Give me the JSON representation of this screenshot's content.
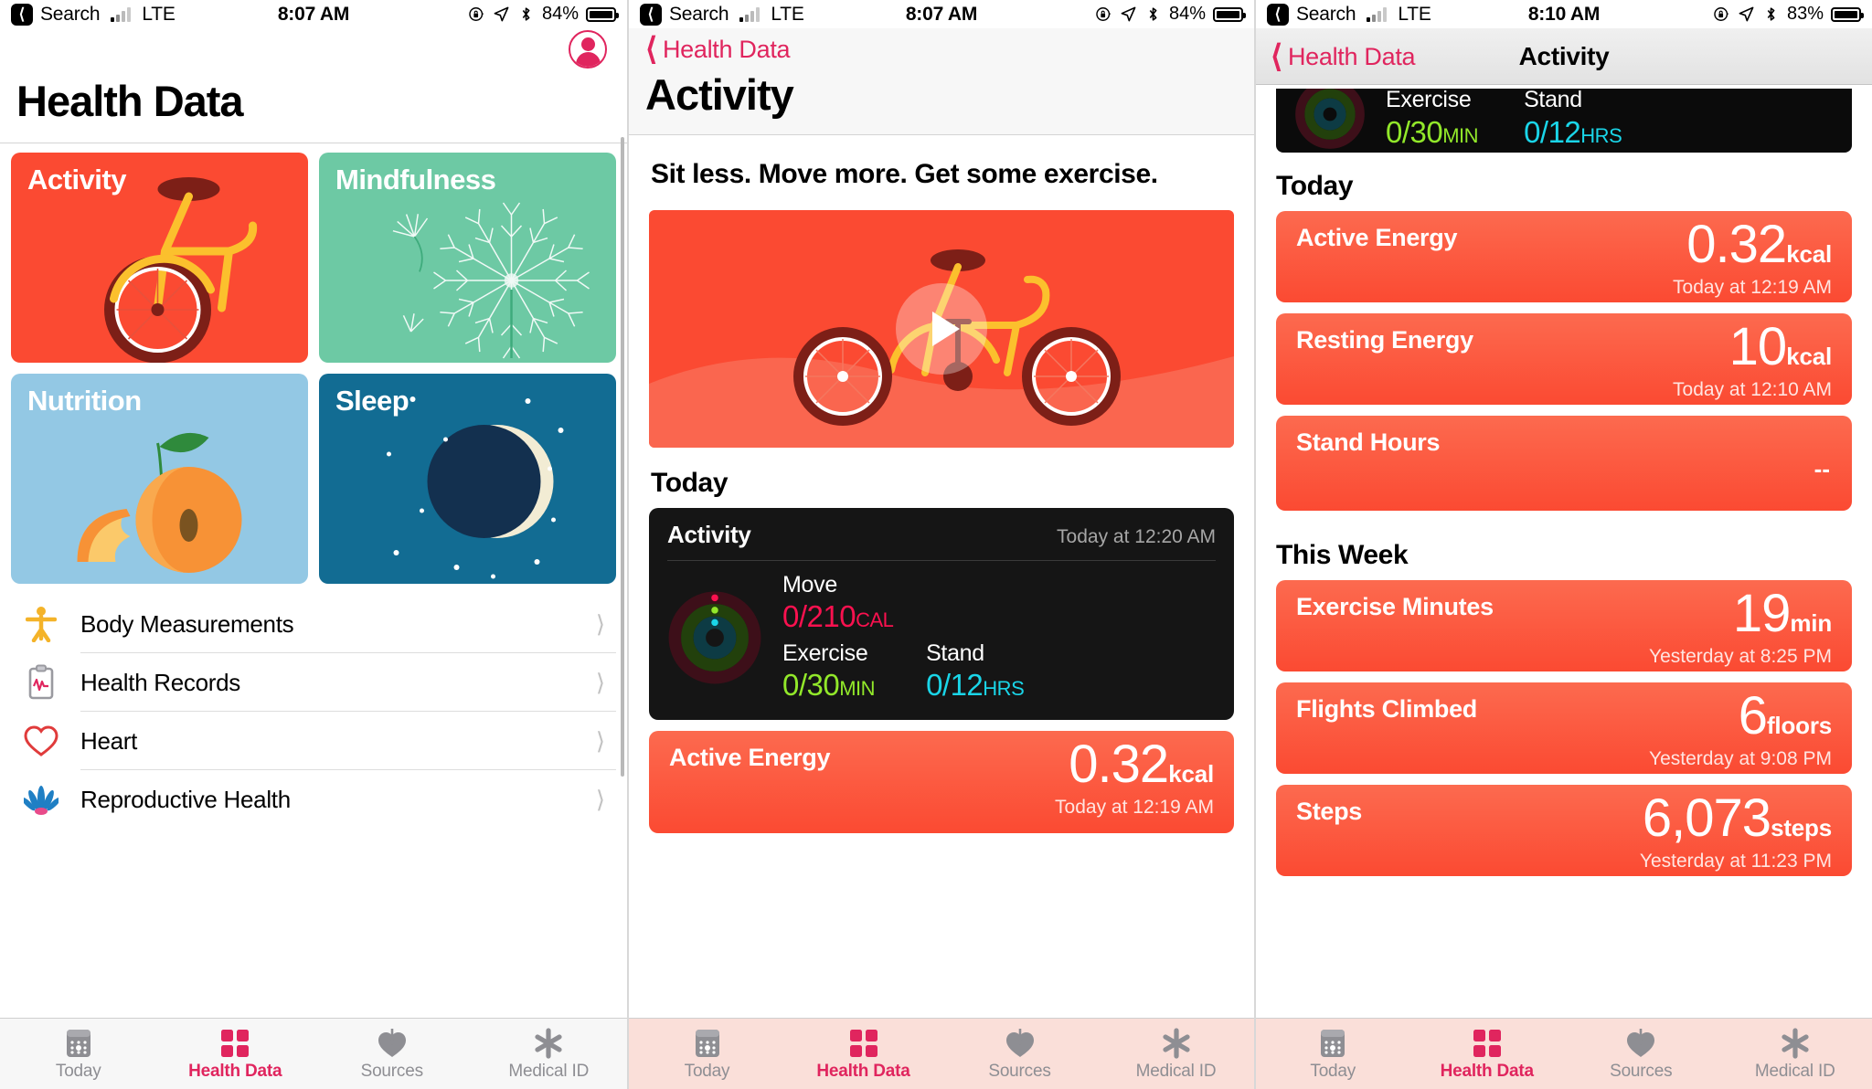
{
  "panel1": {
    "status": {
      "back_label": "Search",
      "carrier": "LTE",
      "time": "8:07 AM",
      "battery_pct": "84%",
      "icons": [
        "rotation-lock-icon",
        "location-arrow-icon",
        "bluetooth-icon",
        "battery-icon"
      ]
    },
    "title": "Health Data",
    "avatar_name": "profile-avatar",
    "tiles": [
      {
        "label": "Activity",
        "color": "#fb4a32",
        "art": "bicycle"
      },
      {
        "label": "Mindfulness",
        "color": "#6dc9a4",
        "art": "dandelion"
      },
      {
        "label": "Nutrition",
        "color": "#93c8e4",
        "art": "peach"
      },
      {
        "label": "Sleep",
        "color": "#126c93",
        "art": "moon"
      }
    ],
    "list": [
      {
        "label": "Body Measurements",
        "icon": "body-figure-icon"
      },
      {
        "label": "Health Records",
        "icon": "clipboard-pulse-icon"
      },
      {
        "label": "Heart",
        "icon": "heart-icon"
      },
      {
        "label": "Reproductive Health",
        "icon": "lotus-icon"
      }
    ],
    "tabs": [
      {
        "label": "Today",
        "icon": "calendar-icon",
        "active": false
      },
      {
        "label": "Health Data",
        "icon": "four-squares-icon",
        "active": true
      },
      {
        "label": "Sources",
        "icon": "heart-download-icon",
        "active": false
      },
      {
        "label": "Medical ID",
        "icon": "asterisk-icon",
        "active": false
      }
    ]
  },
  "panel2": {
    "status": {
      "back_label": "Search",
      "carrier": "LTE",
      "time": "8:07 AM",
      "battery_pct": "84%"
    },
    "back_label": "Health Data",
    "title": "Activity",
    "headline": "Sit less. Move more. Get some exercise.",
    "video_name": "bicycle-video-thumbnail",
    "section_today": "Today",
    "activity_card": {
      "title": "Activity",
      "timestamp": "Today at 12:20 AM",
      "move_label": "Move",
      "move_value": "0/210",
      "move_unit": "CAL",
      "exercise_label": "Exercise",
      "exercise_value": "0/30",
      "exercise_unit": "MIN",
      "stand_label": "Stand",
      "stand_value": "0/12",
      "stand_unit": "HRS"
    },
    "active_energy": {
      "name": "Active Energy",
      "value": "0.32",
      "unit": "kcal",
      "timestamp": "Today at 12:19 AM"
    },
    "tabs": [
      {
        "label": "Today",
        "icon": "calendar-icon",
        "active": false
      },
      {
        "label": "Health Data",
        "icon": "four-squares-icon",
        "active": true
      },
      {
        "label": "Sources",
        "icon": "heart-download-icon",
        "active": false
      },
      {
        "label": "Medical ID",
        "icon": "asterisk-icon",
        "active": false
      }
    ]
  },
  "panel3": {
    "status": {
      "back_label": "Search",
      "carrier": "LTE",
      "time": "8:10 AM",
      "battery_pct": "83%"
    },
    "back_label": "Health Data",
    "nav_title": "Activity",
    "ring_strip": {
      "exercise_label": "Exercise",
      "exercise_value": "0/30",
      "exercise_unit": "MIN",
      "stand_label": "Stand",
      "stand_value": "0/12",
      "stand_unit": "HRS"
    },
    "section_today": "Today",
    "today_cards": [
      {
        "name": "Active Energy",
        "value": "0.32",
        "unit": "kcal",
        "timestamp": "Today at 12:19 AM"
      },
      {
        "name": "Resting Energy",
        "value": "10",
        "unit": "kcal",
        "timestamp": "Today at 12:10 AM"
      },
      {
        "name": "Stand Hours",
        "value": "--",
        "unit": "",
        "timestamp": ""
      }
    ],
    "section_week": "This Week",
    "week_cards": [
      {
        "name": "Exercise Minutes",
        "value": "19",
        "unit": "min",
        "timestamp": "Yesterday at 8:25 PM"
      },
      {
        "name": "Flights Climbed",
        "value": "6",
        "unit": "floors",
        "timestamp": "Yesterday at 9:08 PM"
      },
      {
        "name": "Steps",
        "value": "6,073",
        "unit": "steps",
        "timestamp": "Yesterday at 11:23 PM"
      }
    ],
    "tabs": [
      {
        "label": "Today",
        "icon": "calendar-icon",
        "active": false
      },
      {
        "label": "Health Data",
        "icon": "four-squares-icon",
        "active": true
      },
      {
        "label": "Sources",
        "icon": "heart-download-icon",
        "active": false
      },
      {
        "label": "Medical ID",
        "icon": "asterisk-icon",
        "active": false
      }
    ]
  },
  "colors": {
    "accent_pink": "#e0255e",
    "card_red": "#fb4a32",
    "move_ring": "#fa114f",
    "exercise_ring": "#92e82a",
    "stand_ring": "#1ad5e8"
  }
}
